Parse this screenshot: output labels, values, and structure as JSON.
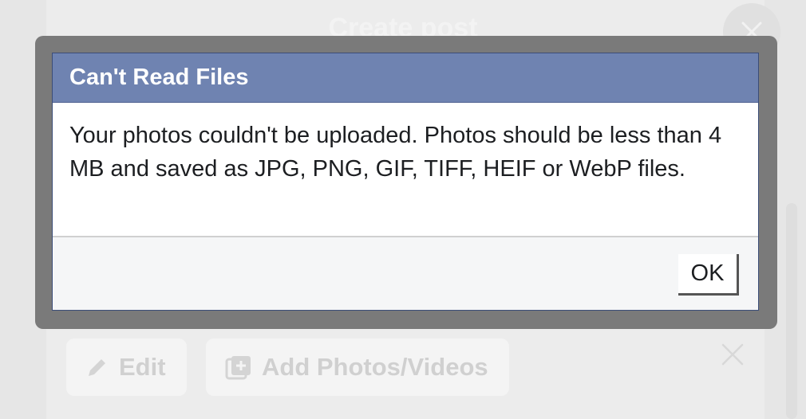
{
  "background": {
    "title": "Create post",
    "edit_label": "Edit",
    "add_media_label": "Add Photos/Videos"
  },
  "dialog": {
    "title": "Can't Read Files",
    "message": "Your photos couldn't be uploaded. Photos should be less than 4 MB and saved as JPG, PNG, GIF, TIFF, HEIF or WebP files.",
    "ok_label": "OK"
  },
  "colors": {
    "header": "#6f83b1",
    "frame": "#7a7a7a",
    "footer": "#f5f6f7"
  }
}
